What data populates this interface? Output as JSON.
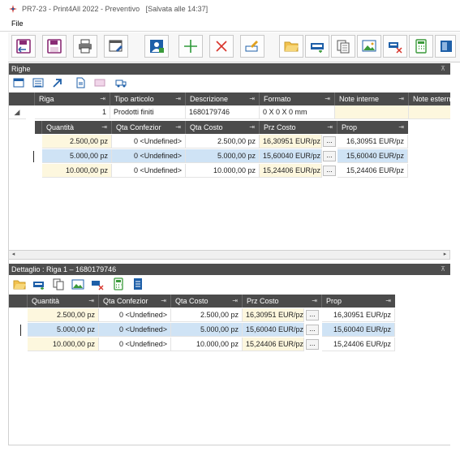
{
  "window": {
    "title": "PR7-23 - Print4All 2022 - Preventivo",
    "saved_status": "[Salvata alle 14:37]"
  },
  "menu": {
    "file": "File"
  },
  "toolbar": {
    "buttons": [
      "save-close",
      "save",
      "print",
      "window-edit",
      "customer-card",
      "add",
      "delete",
      "edit",
      "open-folder",
      "import-card",
      "copy-pages",
      "image-insert",
      "remove-card",
      "calculator",
      "sidebar"
    ]
  },
  "righe": {
    "section_title": "Righe",
    "columns": [
      "Riga",
      "Tipo articolo",
      "Descrizione",
      "Formato",
      "Note interne",
      "Note esterne"
    ],
    "row": {
      "riga": "1",
      "tipo": "Prodotti finiti",
      "descrizione": "1680179746",
      "formato": "0 X 0 X 0 mm",
      "note_interne": "",
      "note_esterne": ""
    },
    "sub_columns": [
      "Quantità",
      "Qta Confezior",
      "Qta Costo",
      "Prz Costo",
      "Prop"
    ],
    "sub_rows": [
      {
        "quantita": "2.500,00 pz",
        "qta_conf": "0 <Undefined>",
        "qta_costo": "2.500,00 pz",
        "prz_costo": "16,30951 EUR/pz",
        "prop": "16,30951 EUR/pz"
      },
      {
        "quantita": "5.000,00 pz",
        "qta_conf": "0 <Undefined>",
        "qta_costo": "5.000,00 pz",
        "prz_costo": "15,60040 EUR/pz",
        "prop": "15,60040 EUR/pz"
      },
      {
        "quantita": "10.000,00 pz",
        "qta_conf": "0 <Undefined>",
        "qta_costo": "10.000,00 pz",
        "prz_costo": "15,24406 EUR/pz",
        "prop": "15,24406 EUR/pz"
      }
    ],
    "selected_index": 1,
    "dots_label": "..."
  },
  "dettaglio": {
    "section_title": "Dettaglio : Riga 1 – 1680179746",
    "columns": [
      "Quantità",
      "Qta Confezior",
      "Qta Costo",
      "Prz Costo",
      "Prop"
    ],
    "rows": [
      {
        "quantita": "2.500,00 pz",
        "qta_conf": "0 <Undefined>",
        "qta_costo": "2.500,00 pz",
        "prz_costo": "16,30951 EUR/pz",
        "prop": "16,30951 EUR/pz"
      },
      {
        "quantita": "5.000,00 pz",
        "qta_conf": "0 <Undefined>",
        "qta_costo": "5.000,00 pz",
        "prz_costo": "15,60040 EUR/pz",
        "prop": "15,60040 EUR/pz"
      },
      {
        "quantita": "10.000,00 pz",
        "qta_conf": "0 <Undefined>",
        "qta_costo": "10.000,00 pz",
        "prz_costo": "15,24406 EUR/pz",
        "prop": "15,24406 EUR/pz"
      }
    ],
    "selected_index": 1
  },
  "colors": {
    "accent_blue": "#1e5fa8",
    "selected_row": "#cfe3f5",
    "editable_cell": "#fdf7de",
    "header_dark": "#4b4b4b"
  }
}
